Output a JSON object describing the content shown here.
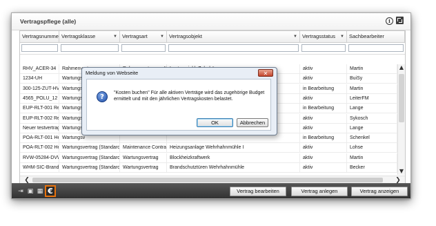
{
  "window": {
    "title": "Vertragspflege (alle)",
    "info_icon": "info-icon",
    "resize_icon": "maximize-icon"
  },
  "grid": {
    "columns": [
      {
        "label": "Vertragsnummer",
        "dropdown": "▼"
      },
      {
        "label": "Vertragsklasse",
        "dropdown": "▼"
      },
      {
        "label": "Vertragsart",
        "dropdown": "▼"
      },
      {
        "label": "Vertragsobjekt",
        "dropdown": "▼"
      },
      {
        "label": "Vertragsstatus",
        "dropdown": "▼"
      },
      {
        "label": "Sachbearbeiter",
        "dropdown": ""
      }
    ],
    "rows": [
      [
        "RHV_ACER-34",
        "Rahmenvertrag",
        "Rahmenvertrag zu Kau",
        "Laptops inkl. Zubehör",
        "aktiv",
        "Martin"
      ],
      [
        "1234-UH",
        "Wartungsv",
        "",
        "",
        "aktiv",
        "BuiSy"
      ],
      [
        "300-125-ZUT-HV4",
        "Wartungsv",
        "",
        "",
        "in Bearbeitung",
        "Martin"
      ],
      [
        "4565_POLU_12",
        "Wartungsv",
        "",
        "",
        "aktiv",
        "LeiterFM"
      ],
      [
        "EUP-RLT-001 Refr",
        "Wartungsv",
        "",
        "",
        "in Bearbeitung",
        "Lange"
      ],
      [
        "EUP-RLT-002 Refr",
        "Wartungsv",
        "",
        "",
        "aktiv",
        "Sykosch"
      ],
      [
        "Neuer testvertrag",
        "Wartungsv",
        "",
        "",
        "aktiv",
        "Lange"
      ],
      [
        "POA-RLT-001 Hea",
        "Wartungsv",
        "",
        "",
        "in Bearbeitung",
        "Schenkel"
      ],
      [
        "POA-RLT-002 Hea",
        "Wartungsvertrag (Standard)",
        "Maintenance Contract",
        "Heizungsanlage Wehrhahnmühle I",
        "aktiv",
        "Lohse"
      ],
      [
        "RVW-05284-DVW",
        "Wartungsvertrag (Standard)",
        "Wartungsvertrag",
        "Blockheizkraftwerk",
        "aktiv",
        "Martin"
      ],
      [
        "WHM-SIC-Brandsc",
        "Wartungsvertrag (Standard)",
        "Wartungsvertrag",
        "Brandschutztüren Wehrhahnmühle",
        "aktiv",
        "Becker"
      ]
    ],
    "scroll_up": "▲",
    "scroll_down": "▼",
    "scroll_left": "❮",
    "scroll_right": "❯"
  },
  "toolbar": {
    "icons": [
      "export-icon",
      "print-icon",
      "film-icon",
      "euro-icon"
    ],
    "icon_glyphs": [
      "⇥",
      "▣",
      "▦"
    ],
    "euro_label": "€",
    "buttons": [
      "Vertrag bearbeiten",
      "Vertrag anlegen",
      "Vertrag anzeigen"
    ]
  },
  "dialog": {
    "title": "Meldung von Webseite",
    "close_label": "✕",
    "icon": "question-icon",
    "icon_glyph": "?",
    "message": "\"Kosten buchen\" Für alle aktiven Verträge wird das zugehörige Budget ermittelt und mit den jährlichen Vertragskosten belastet.",
    "ok_label": "OK",
    "cancel_label": "Abbrechen"
  }
}
